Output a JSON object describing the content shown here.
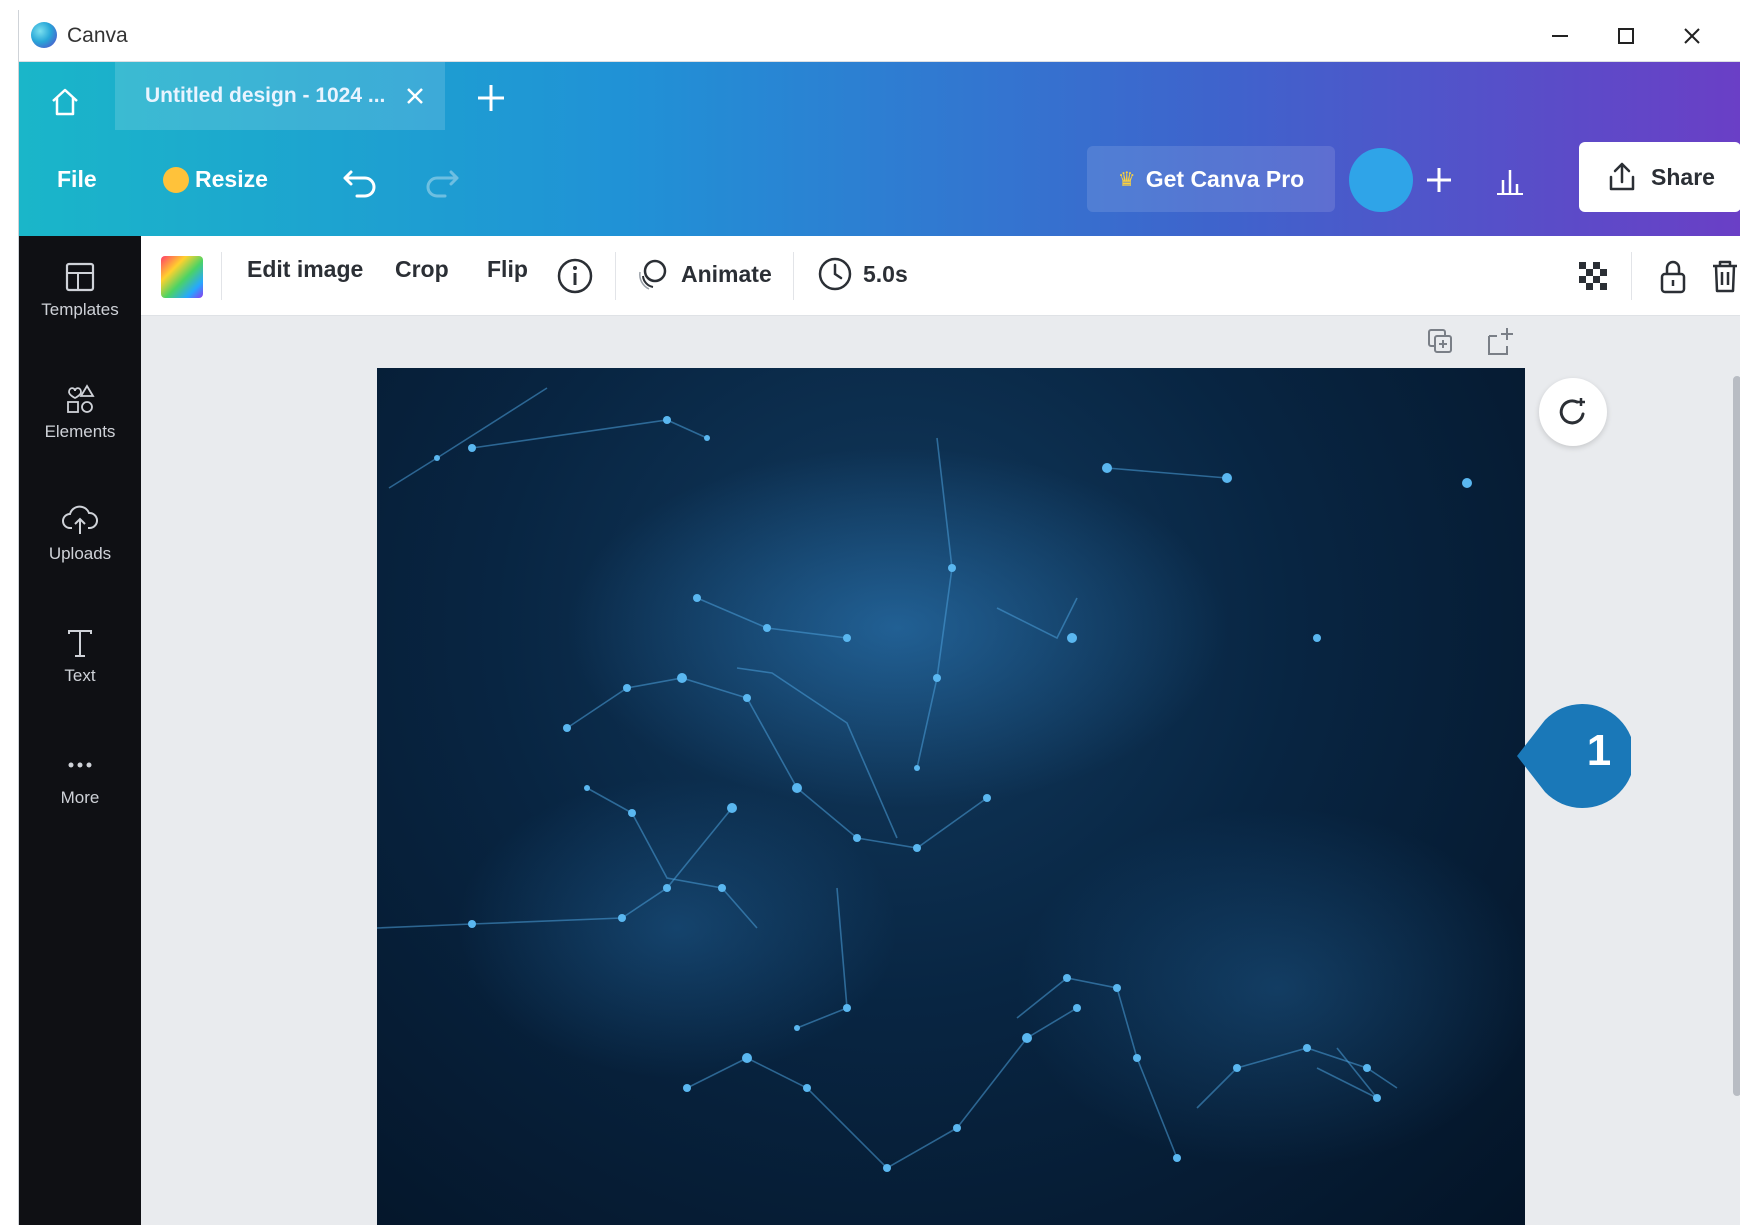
{
  "window": {
    "title": "Canva"
  },
  "tabs": [
    {
      "label": "Untitled design - 1024 ..."
    }
  ],
  "toolbar": {
    "file_label": "File",
    "resize_label": "Resize",
    "pro_label": "Get Canva Pro",
    "share_label": "Share"
  },
  "sidebar": {
    "items": [
      {
        "label": "Templates",
        "icon": "templates-icon"
      },
      {
        "label": "Elements",
        "icon": "elements-icon"
      },
      {
        "label": "Uploads",
        "icon": "uploads-icon"
      },
      {
        "label": "Text",
        "icon": "text-icon"
      },
      {
        "label": "More",
        "icon": "more-icon"
      }
    ]
  },
  "context_toolbar": {
    "edit_image_label": "Edit image",
    "crop_label": "Crop",
    "flip_label": "Flip",
    "animate_label": "Animate",
    "duration_label": "5.0s"
  },
  "callout": {
    "number": "1"
  },
  "colors": {
    "brand_gradient_start": "#1ab6c9",
    "brand_gradient_end": "#6a3fc6",
    "sidebar_bg": "#0f1014",
    "callout_blue": "#1a78b8"
  }
}
